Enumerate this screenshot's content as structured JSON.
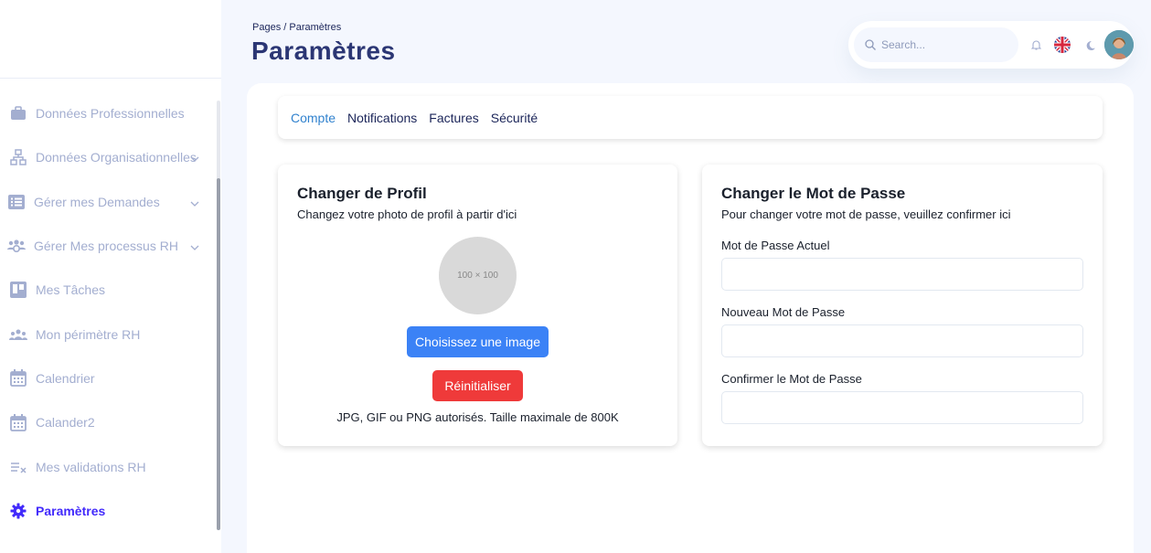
{
  "sidebar": {
    "items": [
      {
        "label": "Données Professionnelles",
        "icon": "briefcase-icon",
        "chevron": false
      },
      {
        "label": "Données Organisationnelles",
        "icon": "sitemap-icon",
        "chevron": true
      },
      {
        "label": "Gérer mes Demandes",
        "icon": "list-icon",
        "chevron": true
      },
      {
        "label": "Gérer Mes processus RH",
        "icon": "users-cog-icon",
        "chevron": true
      },
      {
        "label": "Mes Tâches",
        "icon": "kanban-icon",
        "chevron": false
      },
      {
        "label": "Mon périmètre RH",
        "icon": "team-icon",
        "chevron": false
      },
      {
        "label": "Calendrier",
        "icon": "calendar-icon",
        "chevron": false
      },
      {
        "label": "Calander2",
        "icon": "calendar-icon",
        "chevron": false
      },
      {
        "label": "Mes validations RH",
        "icon": "checklist-icon",
        "chevron": false
      },
      {
        "label": "Paramètres",
        "icon": "gear-icon",
        "chevron": false,
        "active": true
      }
    ]
  },
  "header": {
    "breadcrumb": "Pages / Paramètres",
    "title": "Paramètres",
    "search_placeholder": "Search..."
  },
  "tabs": [
    {
      "label": "Compte",
      "active": true
    },
    {
      "label": "Notifications"
    },
    {
      "label": "Factures"
    },
    {
      "label": "Sécurité"
    }
  ],
  "profile_card": {
    "title": "Changer de Profil",
    "subtitle": "Changez votre photo de profil à partir d'ici",
    "image_placeholder": "100 × 100",
    "choose_button": "Choisissez une image",
    "reset_button": "Réinitialiser",
    "note": "JPG, GIF ou PNG autorisés. Taille maximale de 800K"
  },
  "password_card": {
    "title": "Changer le Mot de Passe",
    "subtitle": "Pour changer votre mot de passe, veuillez confirmer ici",
    "current_label": "Mot de Passe Actuel",
    "new_label": "Nouveau Mot de Passe",
    "confirm_label": "Confirmer le Mot de Passe"
  },
  "colors": {
    "accent": "#422afb",
    "tab_active": "#3182ce",
    "choose_button": "#3b82f6",
    "reset_button": "#ef3a3a",
    "sidebar_text": "#a3aed0"
  }
}
